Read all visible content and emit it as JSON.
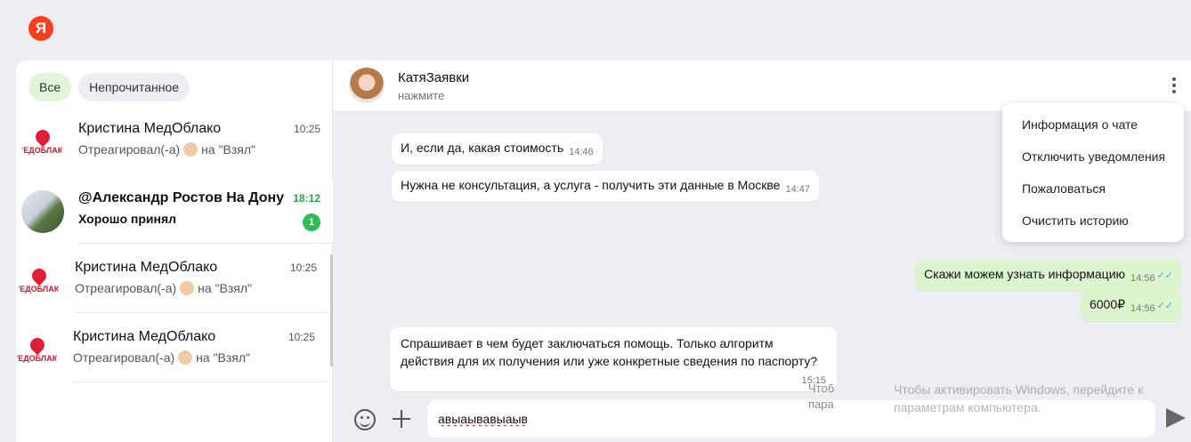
{
  "brand": {
    "logo_letter": "Я",
    "color": "#fc3f1d"
  },
  "filters": {
    "all": "Все",
    "unread": "Непрочитанное"
  },
  "chats": [
    {
      "name": "Кристина МедОблако",
      "time": "10:25",
      "preview_prefix": "Отреагировал(-а)",
      "preview_suffix": "на \"Взял\"",
      "avatar_text": "МЕДОБЛАКО"
    },
    {
      "name": "@Александр Ростов На Дону",
      "time": "18:12",
      "preview": "Хорошо принял",
      "unread_count": "1"
    },
    {
      "name": "Кристина МедОблако",
      "time": "10:25",
      "preview_prefix": "Отреагировал(-а)",
      "preview_suffix": "на \"Взял\"",
      "avatar_text": "МЕДОБЛАКО"
    },
    {
      "name": "Кристина МедОблако",
      "time": "10:25",
      "preview_prefix": "Отреагировал(-а)",
      "preview_suffix": "на \"Взял\"",
      "avatar_text": "МЕДОБЛАКО"
    }
  ],
  "chat_header": {
    "name": "КатяЗаявки",
    "subtitle": "нажмите"
  },
  "messages": [
    {
      "text": "И, если да, какая стоимость",
      "time": "14:46",
      "direction": "in"
    },
    {
      "text": "Нужна не консультация, а услуга - получить эти данные в Москве",
      "time": "14:47",
      "direction": "in"
    },
    {
      "text": "Скажи можем узнать информацию",
      "time": "14:56",
      "direction": "out",
      "ticks": "✓✓"
    },
    {
      "text": "6000₽",
      "time": "14:56",
      "direction": "out",
      "ticks": "✓✓"
    },
    {
      "line1": "Спрашивает в чем будет заключаться помощь. Только алгоритм",
      "line2": "действия для их получения или уже конкретные сведения по паспорту?",
      "time": "15:15",
      "direction": "in"
    }
  ],
  "context_menu": [
    "Информация о чате",
    "Отключить уведомления",
    "Пожаловаться",
    "Очистить историю"
  ],
  "composer": {
    "value": "авыаывавыаыв"
  },
  "windows_watermark": {
    "line1": "Чтобы активировать Windows, перейдите к",
    "line2": "параметрам компьютера.",
    "ghost1": "Чтоб",
    "ghost2": "пара"
  }
}
